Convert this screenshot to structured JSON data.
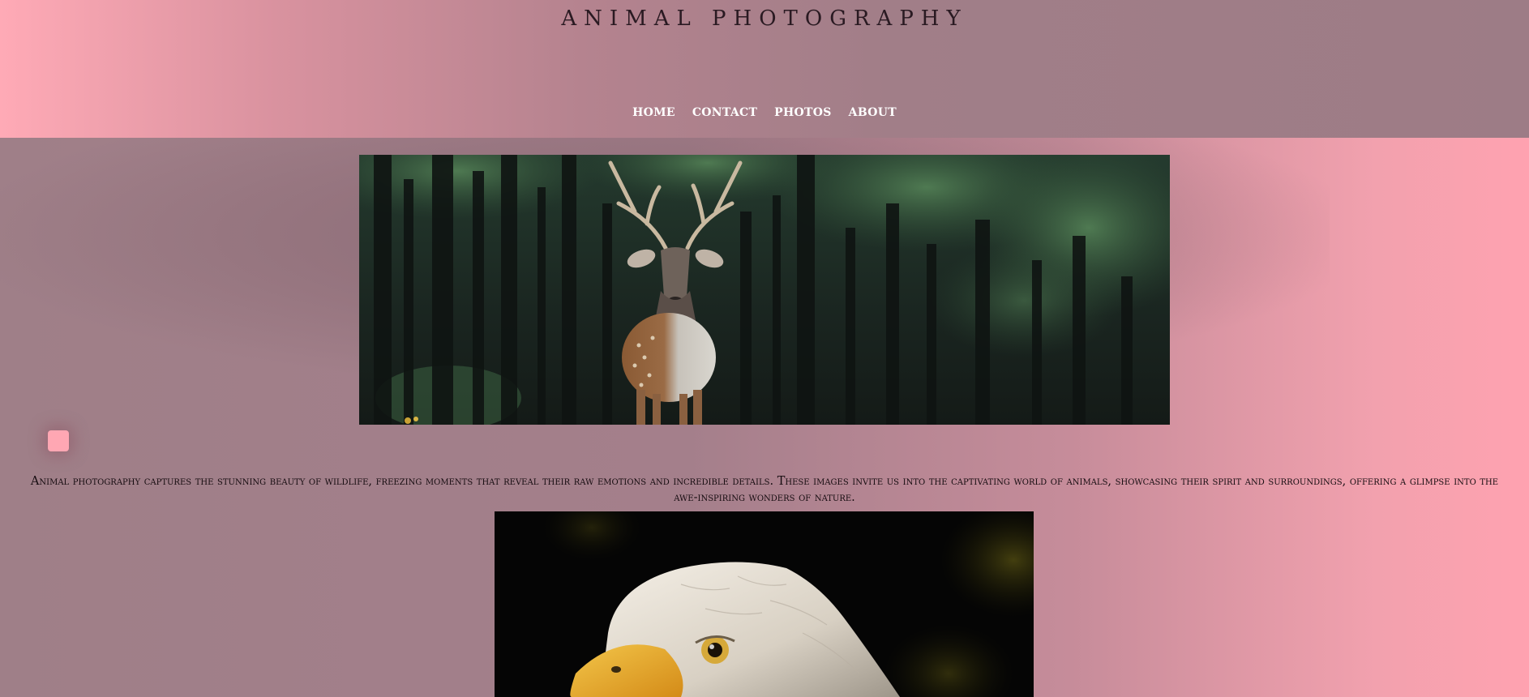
{
  "site": {
    "title": "ANIMAL PHOTOGRAPHY"
  },
  "nav": {
    "items": [
      {
        "label": "HOME"
      },
      {
        "label": "CONTACT"
      },
      {
        "label": "PHOTOS"
      },
      {
        "label": "ABOUT"
      }
    ]
  },
  "main": {
    "intro": "Animal photography captures the stunning beauty of wildlife, freezing moments that reveal their raw emotions and incredible details. These images invite us into the captivating world of animals, showcasing their spirit and surroundings, offering a glimpse into the awe-inspiring wonders of nature.",
    "photos": [
      {
        "subject": "deer in forest"
      },
      {
        "subject": "bald eagle"
      }
    ]
  },
  "colors": {
    "header_left": "#ffaab6",
    "header_right": "#9d7c86",
    "body_right": "#ffa2b0",
    "toggle": "#ffa7b3",
    "title_text": "#2a1a22",
    "nav_text": "#ffffff"
  }
}
